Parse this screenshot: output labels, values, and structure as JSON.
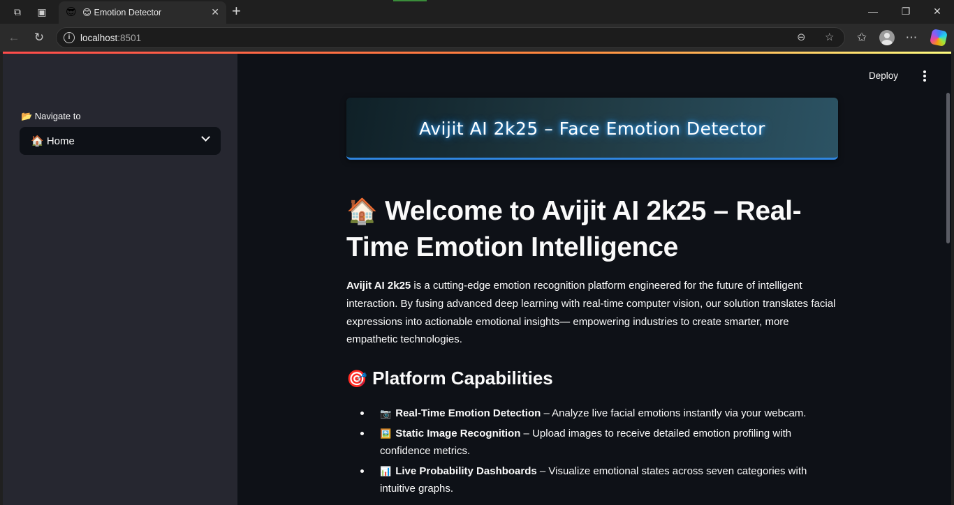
{
  "browser": {
    "tab": {
      "favicon": "😎",
      "title": "😊 Emotion Detector"
    },
    "url": {
      "host": "localhost",
      "port": ":8501"
    }
  },
  "header": {
    "deploy_label": "Deploy"
  },
  "sidebar": {
    "nav_label": "📂 Navigate to",
    "selected_page": "🏠 Home"
  },
  "hero": {
    "title": "Avijit AI 2k25 – Face Emotion Detector"
  },
  "main": {
    "heading_emoji": "🏠",
    "heading": "Welcome to Avijit AI 2k25 – Real-Time Emotion Intelligence",
    "intro_bold": "Avijit AI 2k25",
    "intro_rest": " is a cutting-edge emotion recognition platform engineered for the future of intelligent interaction. By fusing advanced deep learning with real-time computer vision, our solution translates facial expressions into actionable emotional insights— empowering industries to create smarter, more empathetic technologies.",
    "capabilities_emoji": "🎯",
    "capabilities_title": "Platform Capabilities",
    "capabilities": [
      {
        "icon": "📷",
        "title": "Real-Time Emotion Detection",
        "desc": " – Analyze live facial emotions instantly via your webcam."
      },
      {
        "icon": "🖼️",
        "title": "Static Image Recognition",
        "desc": " – Upload images to receive detailed emotion profiling with confidence metrics."
      },
      {
        "icon": "📊",
        "title": "Live Probability Dashboards",
        "desc": " – Visualize emotional states across seven categories with intuitive graphs."
      }
    ]
  }
}
